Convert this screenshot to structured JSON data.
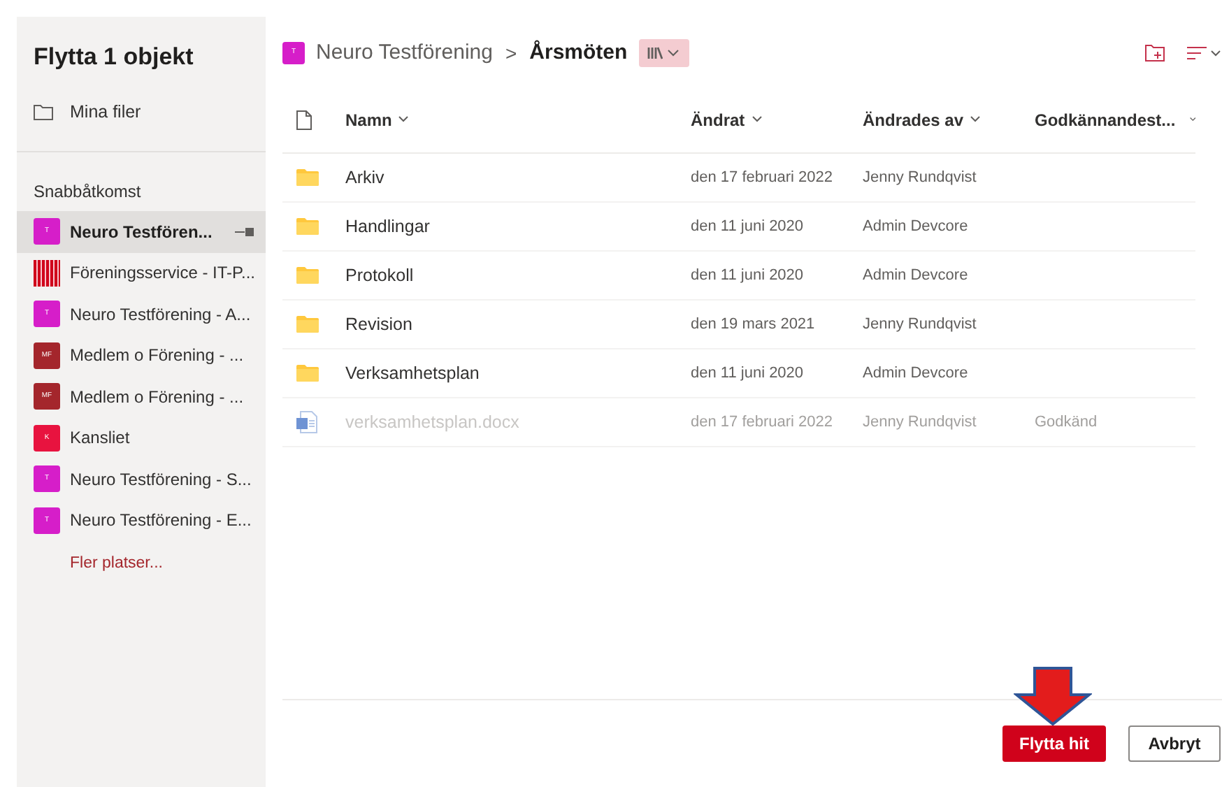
{
  "sidebar": {
    "title": "Flytta 1 objekt",
    "my_files": "Mina filer",
    "section_title": "Snabbåtkomst",
    "items": [
      {
        "kind": "avatar",
        "avatar_text": "T",
        "color": "#d61ec9",
        "label": "Neuro Testfören...",
        "selected": true
      },
      {
        "kind": "logo",
        "label": "Föreningsservice - IT-P...",
        "selected": false
      },
      {
        "kind": "avatar",
        "avatar_text": "T",
        "color": "#d61ec9",
        "label": "Neuro Testförening - A...",
        "selected": false
      },
      {
        "kind": "avatar",
        "avatar_text": "MF",
        "color": "#a4262c",
        "label": "Medlem o Förening - ...",
        "selected": false
      },
      {
        "kind": "avatar",
        "avatar_text": "MF",
        "color": "#a4262c",
        "label": "Medlem o Förening - ...",
        "selected": false
      },
      {
        "kind": "avatar",
        "avatar_text": "K",
        "color": "#e8133f",
        "label": "Kansliet",
        "selected": false
      },
      {
        "kind": "avatar",
        "avatar_text": "T",
        "color": "#d61ec9",
        "label": "Neuro Testförening - S...",
        "selected": false
      },
      {
        "kind": "avatar",
        "avatar_text": "T",
        "color": "#d61ec9",
        "label": "Neuro Testförening - E...",
        "selected": false
      }
    ],
    "more_link": "Fler platser..."
  },
  "breadcrumb": {
    "avatar_text": "T",
    "site": "Neuro Testförening",
    "separator": ">",
    "current": "Årsmöten"
  },
  "table": {
    "columns": [
      "Namn",
      "Ändrat",
      "Ändrades av",
      "Godkännandest..."
    ],
    "rows": [
      {
        "kind": "folder",
        "name": "Arkiv",
        "modified": "den 17 februari 2022",
        "modified_by": "Jenny Rundqvist",
        "disabled": false
      },
      {
        "kind": "folder",
        "name": "Handlingar",
        "modified": "den 11 juni 2020",
        "modified_by": "Admin Devcore",
        "disabled": false
      },
      {
        "kind": "folder",
        "name": "Protokoll",
        "modified": "den 11 juni 2020",
        "modified_by": "Admin Devcore",
        "disabled": false
      },
      {
        "kind": "folder",
        "name": "Revision",
        "modified": "den 19 mars 2021",
        "modified_by": "Jenny Rundqvist",
        "disabled": false
      },
      {
        "kind": "folder",
        "name": "Verksamhetsplan",
        "modified": "den 11 juni 2020",
        "modified_by": "Admin Devcore",
        "disabled": false
      },
      {
        "kind": "word",
        "name": "verksamhetsplan.docx",
        "modified": "den 17 februari 2022",
        "modified_by": "Jenny Rundqvist",
        "approval": "Godkänd",
        "disabled": true
      }
    ]
  },
  "buttons": {
    "primary": "Flytta hit",
    "secondary": "Avbryt"
  }
}
